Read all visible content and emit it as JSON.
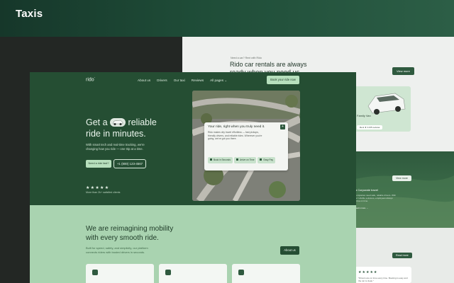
{
  "banner": {
    "title": "Taxis"
  },
  "colors": {
    "primary": "#254e33",
    "accent": "#b7e0bd",
    "lower_bg": "#a9d3b0",
    "dark_bg": "#232724"
  },
  "header": {
    "logo": "rido",
    "nav": [
      "About us",
      "Drivers",
      "Our taxi",
      "Reviews",
      "All pages ⌄"
    ],
    "cta": "Book your ride now"
  },
  "hero": {
    "heading_pre": "Get a",
    "heading_mid": "reliable",
    "heading_post": "ride in minutes.",
    "subtext": "With smart tech and real-time tracking, we're changing how you ride — one trip at a time.",
    "primary_cta": "Need a ride fast?",
    "phone": "+1 (800) 123-4567",
    "rating": "★★★★★",
    "trust_text": "More than 2k+ satisfied clients"
  },
  "booking_card": {
    "title": "Your ride, right when you truly need it.",
    "close_icon": "plus-icon",
    "text": "Rido makes city travel effortless — fast pickups, friendly drivers, and reliable rides. Wherever you're going, we've got you there.",
    "chips": [
      "Book in Seconds",
      "Arrive on Time",
      "Easy Pay"
    ]
  },
  "mission": {
    "heading": "We are reimagining mobility with every smooth ride.",
    "subtext": "Built for speed, safety, and simplicity, our platform connects riders with trusted drivers in seconds.",
    "cta": "About us",
    "feature_icons": [
      "car-icon",
      "user-icon",
      "calendar-icon"
    ]
  },
  "back_card": {
    "kicker": "Need a car? Rent with Rido",
    "heading": "Rido car rentals are always ready when you need us",
    "view_more": "View more",
    "product_label": "Family Van",
    "product_cta": "Rent ★ 4.9/5 reviews",
    "view_more_2": "View more",
    "corporate": "◆ Corporate travel",
    "corporate_text": "Companies need safe, reliable drivers. With our reliable solutions, employees always arrive on time.",
    "learn_more": "Learn more →",
    "read_more": "Read more",
    "review_stars": "★★★★★",
    "review_text": "\"Drivers are on time every time. Booking is easy and the car is clean.\""
  }
}
